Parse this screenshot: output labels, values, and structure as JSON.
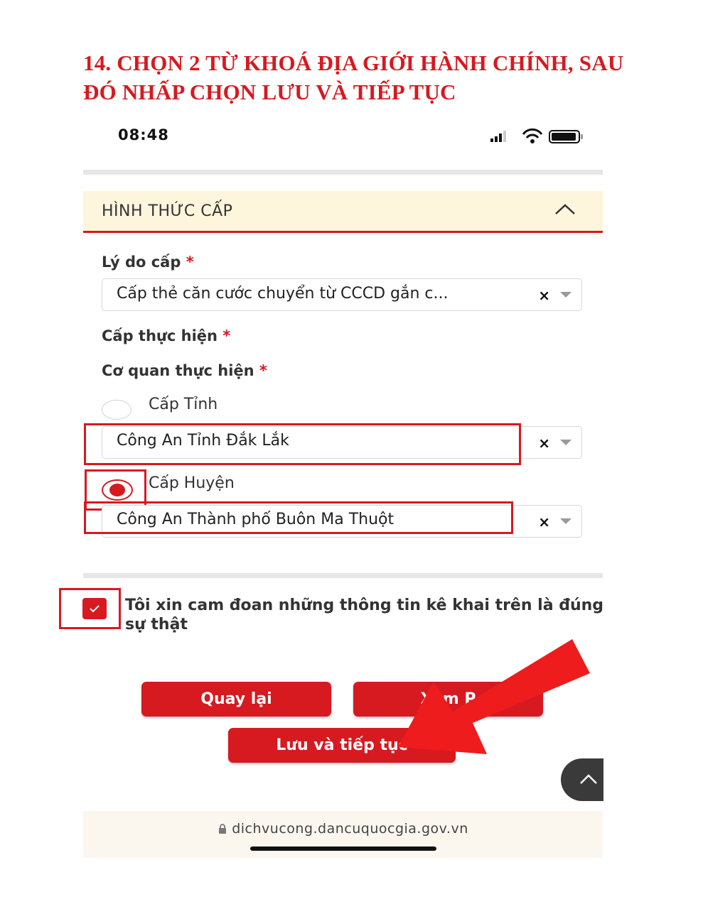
{
  "instruction": {
    "title": "14. CHỌN 2 TỪ KHOÁ ĐỊA GIỚI HÀNH CHÍNH, SAU ĐÓ NHẤP CHỌN LƯU VÀ TIẾP TỤC"
  },
  "status_bar": {
    "time": "08:48"
  },
  "section": {
    "title": "HÌNH THỨC CẤP"
  },
  "form": {
    "reason_label": "Lý do cấp",
    "reason_value": "Cấp thẻ căn cước chuyển từ CCCD gắn c...",
    "level_label": "Cấp thực hiện",
    "agency_label": "Cơ quan thực hiện",
    "required_mark": "*",
    "clear_glyph": "×",
    "options": [
      {
        "label": "Cấp Tỉnh",
        "value": "Công An Tỉnh Đắk Lắk",
        "selected": false
      },
      {
        "label": "Cấp Huyện",
        "value": "Công An Thành phố Buôn Ma Thuột",
        "selected": true
      }
    ]
  },
  "commitment": {
    "text": "Tôi xin cam đoan những thông tin kê khai trên là đúng sự thật",
    "checked": true
  },
  "buttons": {
    "back": "Quay lại",
    "preview": "Xem P",
    "save_continue": "Lưu và tiếp tục"
  },
  "browser": {
    "url": "dichvucong.dancuquocgia.gov.vn"
  },
  "colors": {
    "accent": "#d71920",
    "section_bg": "#fdf5dc",
    "url_bg": "#fbf7ef"
  },
  "icons": [
    "signal-icon",
    "wifi-icon",
    "battery-icon",
    "chevron-up-icon",
    "lock-icon",
    "check-icon",
    "arrow-annotation-icon"
  ]
}
